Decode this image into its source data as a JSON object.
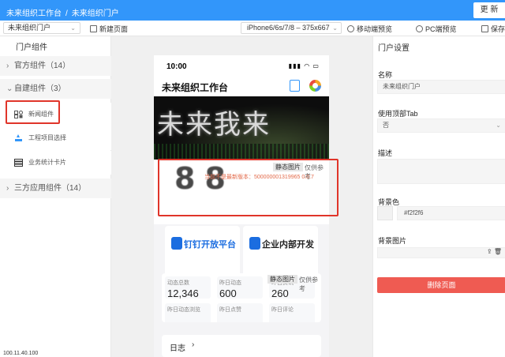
{
  "header": {
    "app_name": "未来组织工作台",
    "separator": "/",
    "page_name": "未来组织门户",
    "update_label": "更 新"
  },
  "toolbar": {
    "portal_select_value": "未来组织门户",
    "new_page_label": "新建页面",
    "device_select_value": "iPhone6/6s/7/8 – 375x667",
    "mobile_preview_label": "移动端预览",
    "pc_preview_label": "PC端预览",
    "save_label": "保存"
  },
  "left_panel": {
    "title": "门户组件",
    "groups": [
      {
        "label": "官方组件（14）",
        "expanded": false
      },
      {
        "label": "自建组件（3）",
        "expanded": true
      },
      {
        "label": "三方应用组件（14）",
        "expanded": false
      }
    ],
    "custom_components": [
      {
        "label": "新闻组件",
        "icon": "news-icon"
      },
      {
        "label": "工程项目选择",
        "icon": "project-icon"
      },
      {
        "label": "业务统计卡片",
        "icon": "stats-icon"
      }
    ]
  },
  "phone": {
    "time": "10:00",
    "app_title": "未来组织工作台",
    "banner_text": "未来我来",
    "news_ghost_text": "88",
    "news_tag": "静态图片",
    "news_note": "仅供参考",
    "news_warning": "当前不是最新版本：500000001319965 0.0.7",
    "apps": [
      {
        "name": "钉钉开放平台"
      },
      {
        "name": "企业内部开发"
      }
    ],
    "stats_tag": "静态图片",
    "stats_note": "仅供参考",
    "stats": [
      {
        "label": "动态总数",
        "value": "12,346"
      },
      {
        "label": "昨日动态",
        "value": "600"
      },
      {
        "label": "昨日资讯",
        "value": "260"
      },
      {
        "label": "昨日动态浏览",
        "value": ""
      },
      {
        "label": "昨日点赞",
        "value": ""
      },
      {
        "label": "昨日评论",
        "value": ""
      }
    ],
    "diary_label": "日志"
  },
  "right_panel": {
    "title": "门户设置",
    "name_label": "名称",
    "name_value": "未来组织门户",
    "tab_label": "使用顶部Tab",
    "tab_value": "否",
    "desc_label": "描述",
    "bg_color_label": "背景色",
    "bg_color_value": "#f2f2f6",
    "bg_image_label": "背景图片",
    "delete_label": "删除页面"
  },
  "footer_stamp": "100.11.40.100",
  "colors": {
    "accent": "#3296fa",
    "danger": "#ef5b52",
    "highlight": "#e0352a"
  }
}
